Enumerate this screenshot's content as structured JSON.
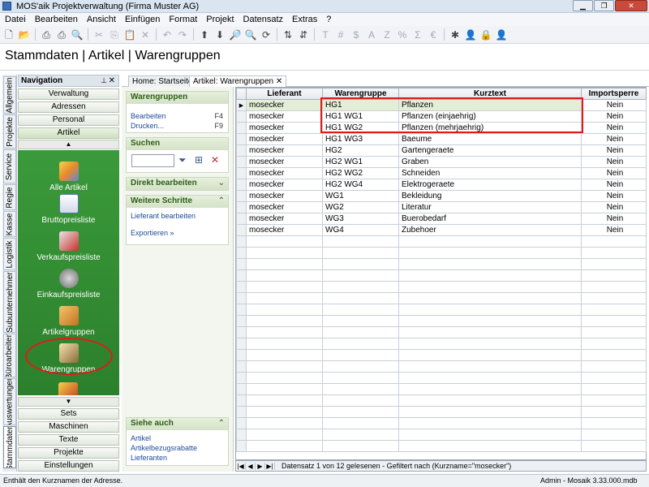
{
  "window": {
    "title": "MOS'aik Projektverwaltung (Firma Muster AG)"
  },
  "menu": [
    "Datei",
    "Bearbeiten",
    "Ansicht",
    "Einfügen",
    "Format",
    "Projekt",
    "Datensatz",
    "Extras",
    "?"
  ],
  "breadcrumb": "Stammdaten | Artikel | Warengruppen",
  "side_tabs": [
    "Allgemein",
    "Projekte",
    "Service",
    "Regie",
    "Kasse",
    "Logistik",
    "Subunternehmer",
    "Büroarbeiten",
    "Auswertungen",
    "Stammdaten"
  ],
  "navigation": {
    "title": "Navigation",
    "top_buttons": [
      "Verwaltung",
      "Adressen",
      "Personal",
      "Artikel"
    ],
    "items": [
      "Alle Artikel",
      "Bruttopreisliste",
      "Verkaufspreisliste",
      "Einkaufspreisliste",
      "Artikelgruppen",
      "Warengruppen"
    ],
    "bottom_buttons": [
      "Sets",
      "Maschinen",
      "Texte",
      "Projekte",
      "Einstellungen"
    ]
  },
  "tabs": [
    {
      "label": "Home: Startseite"
    },
    {
      "label": "Artikel: Warengruppen"
    }
  ],
  "taskpane": {
    "warengruppen": {
      "title": "Warengruppen",
      "links": [
        {
          "label": "Bearbeiten",
          "key": "F4"
        },
        {
          "label": "Drucken...",
          "key": "F9"
        }
      ]
    },
    "suchen": {
      "title": "Suchen"
    },
    "direkt": {
      "title": "Direkt bearbeiten"
    },
    "weitere": {
      "title": "Weitere Schritte",
      "links": [
        "Lieferant bearbeiten",
        "Exportieren »"
      ]
    },
    "siehe": {
      "title": "Siehe auch",
      "links": [
        "Artikel",
        "Artikelbezugsrabatte",
        "Lieferanten"
      ]
    }
  },
  "grid": {
    "columns": [
      "Lieferant",
      "Warengruppe",
      "Kurztext",
      "Importsperre"
    ],
    "rows": [
      [
        "mosecker",
        "HG1",
        "Pflanzen",
        "Nein"
      ],
      [
        "mosecker",
        "HG1 WG1",
        "Pflanzen (einjaehrig)",
        "Nein"
      ],
      [
        "mosecker",
        "HG1 WG2",
        "Pflanzen (mehrjaehrig)",
        "Nein"
      ],
      [
        "mosecker",
        "HG1 WG3",
        "Baeume",
        "Nein"
      ],
      [
        "mosecker",
        "HG2",
        "Gartengeraete",
        "Nein"
      ],
      [
        "mosecker",
        "HG2 WG1",
        "Graben",
        "Nein"
      ],
      [
        "mosecker",
        "HG2 WG2",
        "Schneiden",
        "Nein"
      ],
      [
        "mosecker",
        "HG2 WG4",
        "Elektrogeraete",
        "Nein"
      ],
      [
        "mosecker",
        "WG1",
        "Bekleidung",
        "Nein"
      ],
      [
        "mosecker",
        "WG2",
        "Literatur",
        "Nein"
      ],
      [
        "mosecker",
        "WG3",
        "Buerobedarf",
        "Nein"
      ],
      [
        "mosecker",
        "WG4",
        "Zubehoer",
        "Nein"
      ]
    ],
    "record_status": "Datensatz 1 von 12 gelesenen - Gefiltert nach (Kurzname=\"mosecker\")"
  },
  "status": {
    "left": "Enthält den Kurznamen der Adresse.",
    "right": "Admin - Mosaik 3.33.000.mdb"
  }
}
